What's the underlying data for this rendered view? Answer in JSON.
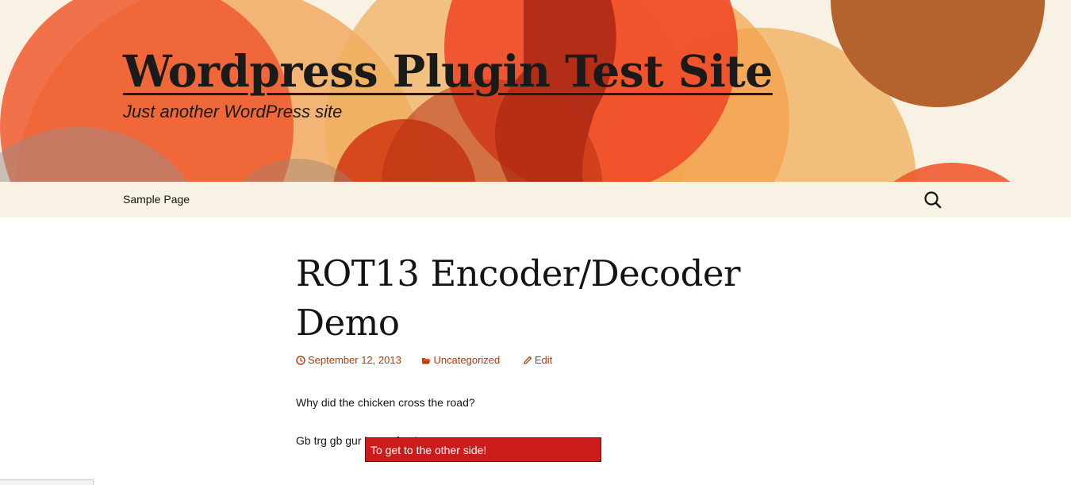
{
  "header": {
    "site_title": "Wordpress Plugin Test Site",
    "site_description": "Just another WordPress site"
  },
  "nav": {
    "items": [
      {
        "label": "Sample Page"
      }
    ],
    "search_icon": "search-icon"
  },
  "post": {
    "title": "ROT13 Encoder/Decoder Demo",
    "meta": {
      "date": "September 12, 2013",
      "category": "Uncategorized",
      "edit": "Edit",
      "date_icon": "clock-icon",
      "category_icon": "folder-icon",
      "edit_icon": "pencil-icon"
    },
    "paragraphs": [
      "Why did the chicken cross the road?",
      "Gb trg gb gur bgure fvqr!"
    ],
    "tooltip": "To get to the other side!"
  },
  "colors": {
    "header_bg": "#f8f2e4",
    "link": "#bc360a",
    "tooltip_bg": "#cc1b1b",
    "text": "#141412"
  }
}
